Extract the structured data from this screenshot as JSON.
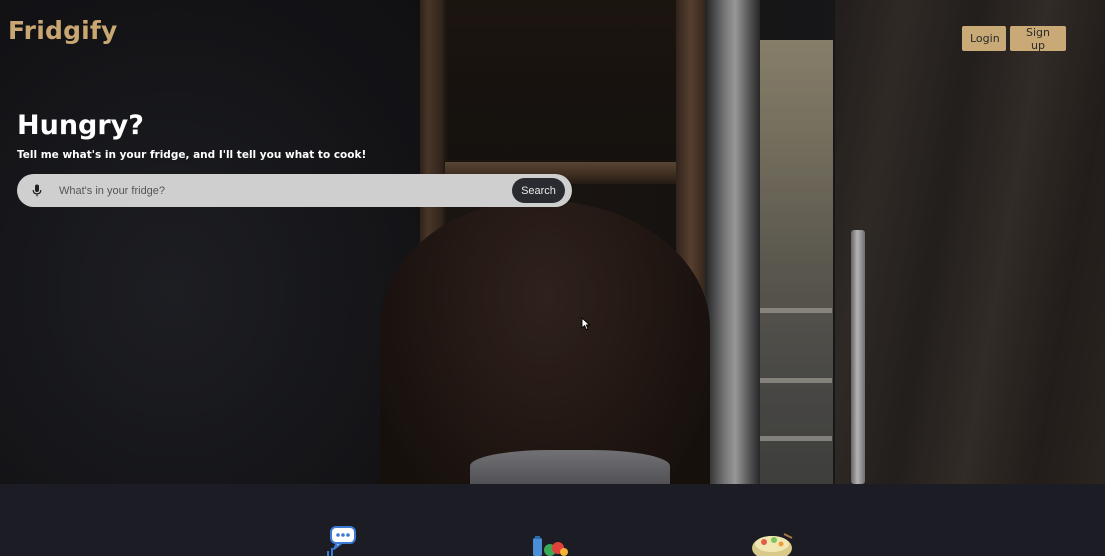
{
  "header": {
    "brand": "Fridgify",
    "login_label": "Login",
    "signup_label": "Sign up"
  },
  "hero": {
    "headline": "Hungry?",
    "tagline": "Tell me what's in your fridge, and I'll tell you what to cook!"
  },
  "search": {
    "placeholder": "What's in your fridge?",
    "value": "",
    "button_label": "Search",
    "mic_icon": "microphone-icon"
  },
  "features": {
    "icons": [
      "chat-bubble-icon",
      "groceries-icon",
      "food-bowl-icon"
    ]
  },
  "colors": {
    "accent": "#c8a772",
    "button_bg": "#c9a975",
    "search_bg": "#cfcfcf",
    "search_button_bg": "#2a2b31",
    "lower_bg": "#1c1c24"
  }
}
